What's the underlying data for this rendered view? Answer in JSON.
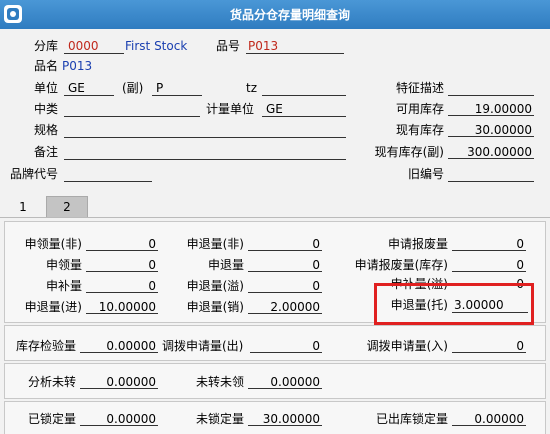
{
  "window": {
    "title": "货品分仓存量明细查询"
  },
  "header": {
    "warehouse_label": "分库",
    "warehouse_code": "0000",
    "warehouse_name": "First Stock",
    "item_no_label": "品号",
    "item_no": "P013",
    "item_name_label": "品名",
    "item_name": "P013",
    "unit_label": "单位",
    "unit": "GE",
    "sub_unit_label": "(副)",
    "sub_unit": "P",
    "tz_label": "tz",
    "tz_value": "",
    "feature_label": "特征描述",
    "feature_value": "",
    "category_label": "中类",
    "category_value": "",
    "calc_unit_label": "计量单位",
    "calc_unit": "GE",
    "available_label": "可用库存",
    "available": "19.00000",
    "spec_label": "规格",
    "spec_value": "",
    "current_label": "现有库存",
    "current": "30.00000",
    "remark_label": "备注",
    "remark_value": "",
    "current_sub_label": "现有库存(副)",
    "current_sub": "300.00000",
    "brand_label": "品牌代号",
    "brand_value": "",
    "old_no_label": "旧编号",
    "old_no_value": ""
  },
  "tabs": [
    {
      "label": "1"
    },
    {
      "label": "2"
    }
  ],
  "panel1": {
    "req_out_non_label": "申领量(非)",
    "req_out_non": "0",
    "ret_non_label": "申退量(非)",
    "ret_non": "0",
    "scrap_label": "申请报废量",
    "scrap": "0",
    "req_out_label": "申领量",
    "req_out": "0",
    "ret_label": "申退量",
    "ret": "0",
    "scrap_stock_label": "申请报废量(库存)",
    "scrap_stock": "0",
    "supp_label": "申补量",
    "supp": "0",
    "ret_surplus_label": "申退量(溢)",
    "ret_surplus": "0",
    "supp_surplus_label": "申补量(溢)",
    "supp_surplus": "0",
    "ret_in_label": "申退量(进)",
    "ret_in": "10.00000",
    "ret_sale_label": "申退量(销)",
    "ret_sale": "2.00000",
    "ret_consign_label": "申退量(托)",
    "ret_consign": "3.00000"
  },
  "panel2": {
    "inspect_label": "库存检验量",
    "inspect": "0.00000",
    "transfer_out_label": "调拨申请量(出)",
    "transfer_out": "0",
    "transfer_in_label": "调拨申请量(入)",
    "transfer_in": "0"
  },
  "panel3": {
    "unanalyzed_label": "分析未转",
    "unanalyzed": "0.00000",
    "untransferred_label": "未转未领",
    "untransferred": "0.00000"
  },
  "panel4": {
    "locked_label": "已锁定量",
    "locked": "0.00000",
    "unlocked_label": "未锁定量",
    "unlocked": "30.00000",
    "shipped_locked_label": "已出库锁定量",
    "shipped_locked": "0.00000"
  }
}
